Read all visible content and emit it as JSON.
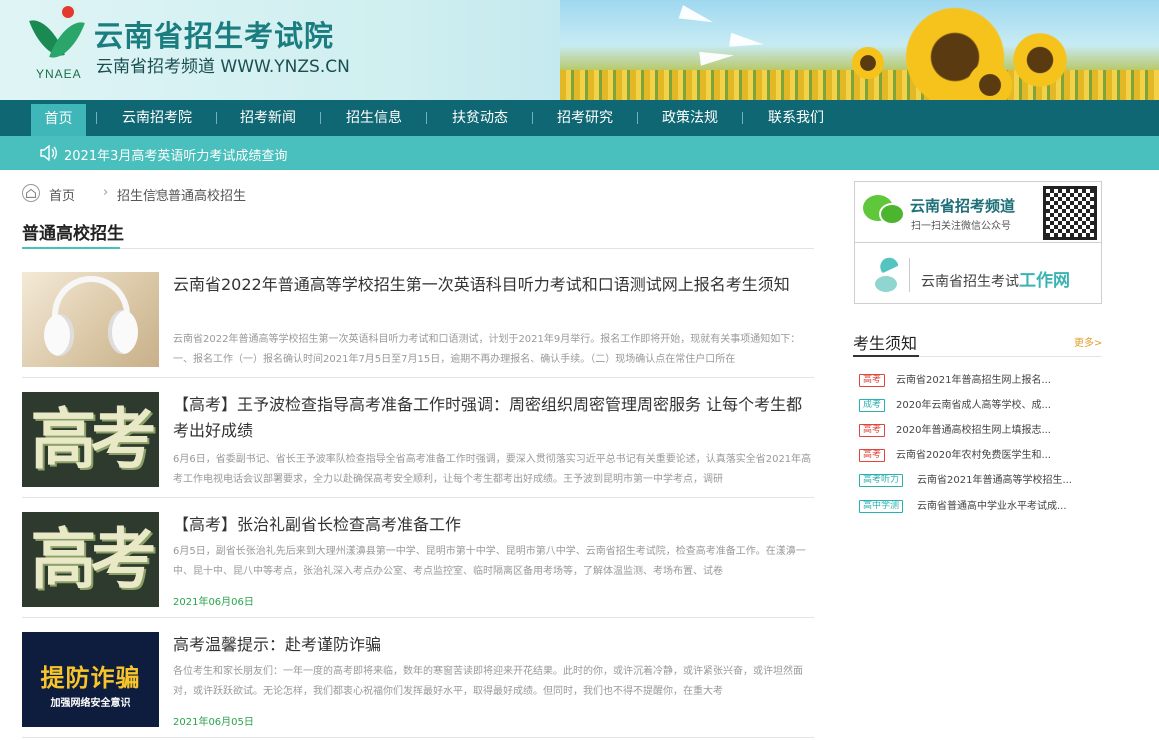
{
  "header": {
    "logo_text": "YNAEA",
    "brand": "云南省招生考试院",
    "subtitle": "云南省招考频道 WWW.YNZS.CN"
  },
  "nav": {
    "items": [
      {
        "label": "首页",
        "active": true
      },
      {
        "label": "云南招考院",
        "active": false
      },
      {
        "label": "招考新闻",
        "active": false
      },
      {
        "label": "招生信息",
        "active": false
      },
      {
        "label": "扶贫动态",
        "active": false
      },
      {
        "label": "招考研究",
        "active": false
      },
      {
        "label": "政策法规",
        "active": false
      },
      {
        "label": "联系我们",
        "active": false
      }
    ]
  },
  "notice": {
    "text": "2021年3月高考英语听力考试成绩查询",
    "icon": "speaker-icon"
  },
  "breadcrumb": {
    "items": [
      "首页",
      "招生信息",
      "普通高校招生"
    ],
    "separator": "›"
  },
  "section": {
    "title": "普通高校招生"
  },
  "articles": [
    {
      "title": "云南省2022年普通高等学校招生第一次英语科目听力考试和口语测试网上报名考生须知",
      "desc": "云南省2022年普通高等学校招生第一次英语科目听力考试和口语测试，计划于2021年9月举行。报名工作即将开始，现就有关事项通知如下：一、报名工作（一）报名确认时间2021年7月5日至7月15日，逾期不再办理报名、确认手续。（二）现场确认点在常住户口所在",
      "date": "",
      "thumb_text": ""
    },
    {
      "title": "【高考】王予波检查指导高考准备工作时强调：周密组织周密管理周密服务 让每个考生都考出好成绩",
      "desc": "6月6日，省委副书记、省长王予波率队检查指导全省高考准备工作时强调，要深入贯彻落实习近平总书记有关重要论述，认真落实全省2021年高考工作电视电话会议部署要求，全力以赴确保高考安全顺利，让每个考生都考出好成绩。王予波到昆明市第一中学考点，调研",
      "date": "",
      "thumb_text": "高考"
    },
    {
      "title": "【高考】张治礼副省长检查高考准备工作",
      "desc": "6月5日，副省长张治礼先后来到大理州漾濞县第一中学、昆明市第十中学、昆明市第八中学、云南省招生考试院，检查高考准备工作。在漾濞一中、昆十中、昆八中等考点，张治礼深入考点办公室、考点监控室、临时隔离区备用考场等，了解体温监测、考场布置、试卷",
      "date": "2021年06月06日",
      "thumb_text": "高考"
    },
    {
      "title": "高考温馨提示：赴考谨防诈骗",
      "desc": "各位考生和家长朋友们：一年一度的高考即将来临，数年的寒窗苦读即将迎来开花结果。此时的你，或许沉着冷静，或许紧张兴奋，或许坦然面对，或许跃跃欲试。无论怎样，我们都衷心祝福你们发挥最好水平，取得最好成绩。但同时，我们也不得不提醒你，在重大考",
      "date": "2021年06月05日",
      "thumb_text": "提防诈骗",
      "thumb_sub": "加强网络安全意识"
    }
  ],
  "sidebar": {
    "wechat_title": "云南省招考频道",
    "wechat_sub": "扫一扫关注微信公众号",
    "network_text": "云南省招生考试",
    "network_bold": "工作网",
    "news_title": "考生须知",
    "more": "更多>",
    "news": [
      {
        "tag": "高考",
        "tag_color": "red",
        "text": "云南省2021年普高招生网上报名..."
      },
      {
        "tag": "成考",
        "tag_color": "teal",
        "text": "2020年云南省成人高等学校、成..."
      },
      {
        "tag": "高考",
        "tag_color": "red",
        "text": "2020年普通高校招生网上填报志..."
      },
      {
        "tag": "高考",
        "tag_color": "red",
        "text": "云南省2020年农村免费医学生和..."
      },
      {
        "tag": "高考听力",
        "tag_color": "teal",
        "text": "云南省2021年普通高等学校招生..."
      },
      {
        "tag": "高中学测",
        "tag_color": "teal",
        "text": "云南省普通高中学业水平考试成..."
      }
    ]
  }
}
